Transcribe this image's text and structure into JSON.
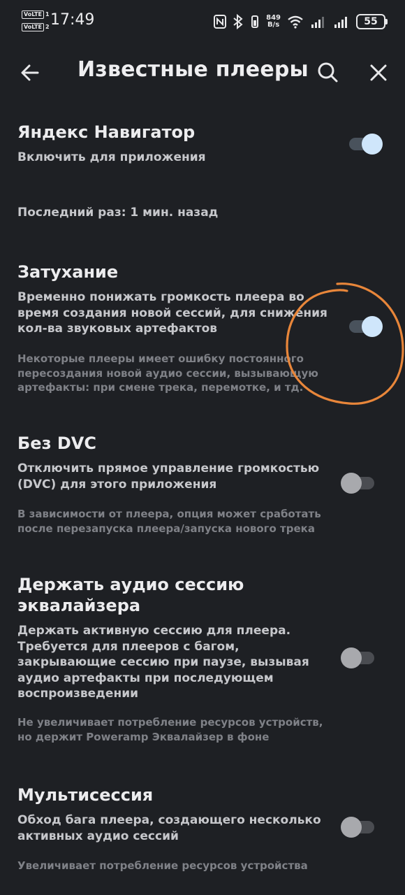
{
  "status_bar": {
    "time": "17:49",
    "volte_label": "VoLTE",
    "sim1": "1",
    "sim2": "2",
    "net_speed_value": "849",
    "net_speed_unit": "B/s",
    "battery": "55"
  },
  "app_bar": {
    "title": "Известные плееры",
    "icons": [
      "back-arrow-icon",
      "search-icon",
      "close-icon"
    ]
  },
  "settings": {
    "yandex": {
      "title": "Яндекс Навигатор",
      "desc": "Включить для приложения",
      "enabled": true
    },
    "last_seen": "Последний раз: 1 мин. назад",
    "fade": {
      "title": "Затухание",
      "desc": "Временно понижать громкость плеера во время создания новой сессий, для снижения кол-ва звуковых артефактов",
      "note": "Некоторые плееры имеет ошибку постоянного пересоздания новой аудио сессии, вызывающую артефакты: при смене трека, перемотке, и тд.",
      "enabled": true
    },
    "no_dvc": {
      "title": "Без DVC",
      "desc": "Отключить прямое управление громкостью (DVC) для этого приложения",
      "note": "В зависимости от плеера, опция может сработать после перезапуска плеера/запуска нового трека",
      "enabled": false
    },
    "keep_session": {
      "title": "Держать аудио сессию эквалайзера",
      "desc": "Держать активную сессию для плеера. Требуется для плееров с багом, закрывающие сессию при паузе, вызывая аудио артефакты при последующем воспроизведении",
      "note": "Не увеличивает потребление ресурсов устройств, но держит Poweramp Эквалайзер в фоне",
      "enabled": false
    },
    "multisession": {
      "title": "Мультисессия",
      "desc": "Обход бага плеера, создающего несколько активных аудио сессий",
      "note": "Увеличивает потребление ресурсов устройства",
      "enabled": false
    }
  },
  "colors": {
    "background": "#1e2024",
    "switch_on_thumb": "#cfe6fb",
    "annotation_circle": "#e8863a"
  }
}
